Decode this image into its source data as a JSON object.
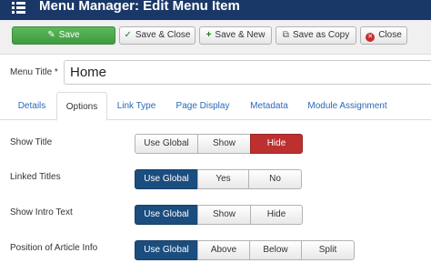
{
  "header": {
    "title": "Menu Manager: Edit Menu Item",
    "icon": "list-icon",
    "background": "#1a3867"
  },
  "toolbar": {
    "buttons": [
      {
        "label": "Save",
        "icon": "edit-icon"
      },
      {
        "label": "Save & Close",
        "icon": "check-icon"
      },
      {
        "label": "Save & New",
        "icon": "plus-icon"
      },
      {
        "label": "Save as Copy",
        "icon": "copy-icon"
      },
      {
        "label": "Close",
        "icon": "close-circle-icon"
      }
    ],
    "save_color": "#4cae4c",
    "close_icon_color": "#c62d2d"
  },
  "menu_title": {
    "label": "Menu Title *",
    "value": "Home"
  },
  "tabs": [
    {
      "label": "Details",
      "active": false
    },
    {
      "label": "Options",
      "active": true
    },
    {
      "label": "Link Type",
      "active": false
    },
    {
      "label": "Page Display",
      "active": false
    },
    {
      "label": "Metadata",
      "active": false
    },
    {
      "label": "Module Assignment",
      "active": false
    }
  ],
  "options": [
    {
      "label": "Show Title",
      "choices": [
        "Use Global",
        "Show",
        "Hide"
      ],
      "selected": "Hide"
    },
    {
      "label": "Linked Titles",
      "choices": [
        "Use Global",
        "Yes",
        "No"
      ],
      "selected": "Use Global"
    },
    {
      "label": "Show Intro Text",
      "choices": [
        "Use Global",
        "Show",
        "Hide"
      ],
      "selected": "Use Global"
    },
    {
      "label": "Position of Article Info",
      "choices": [
        "Use Global",
        "Above",
        "Below",
        "Split"
      ],
      "selected": "Use Global"
    }
  ],
  "colors": {
    "selected_global": "#1b4d7e",
    "selected_hide": "#bd3030",
    "link": "#2a69b8"
  }
}
